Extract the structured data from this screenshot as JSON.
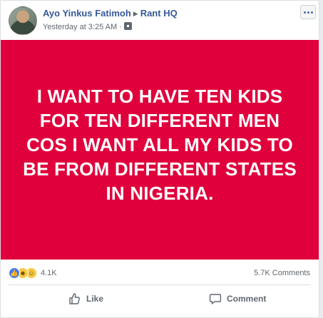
{
  "post": {
    "author": "Ayo Yinkus Fatimoh",
    "group": "Rant HQ",
    "timestamp": "Yesterday at 3:25 AM",
    "meta_separator": "·",
    "text": "I WANT TO HAVE TEN KIDS FOR TEN DIFFERENT MEN COS I WANT ALL MY KIDS TO BE FROM DIFFERENT STATES IN NIGERIA.",
    "background_color": "#e0003c"
  },
  "reactions": {
    "icons": [
      "like-icon",
      "haha-icon",
      "wow-icon"
    ],
    "count": "4.1K",
    "comments_count": "5.7K Comments"
  },
  "actions": {
    "like_label": "Like",
    "comment_label": "Comment"
  },
  "colors": {
    "link": "#365899",
    "muted": "#616770",
    "like_blue": "#4b7bec",
    "emoji_yellow": "#f7c843"
  }
}
